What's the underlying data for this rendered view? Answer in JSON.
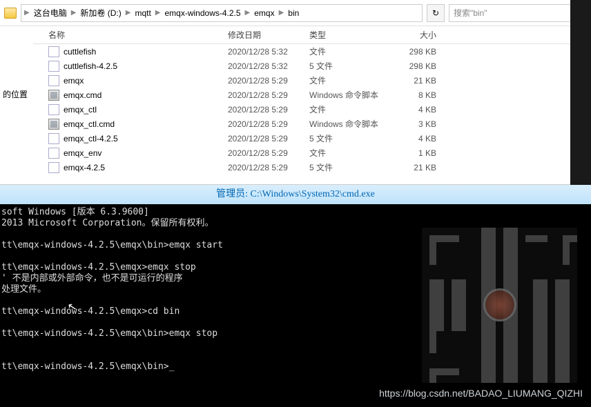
{
  "breadcrumb": [
    "这台电脑",
    "新加卷 (D:)",
    "mqtt",
    "emqx-windows-4.2.5",
    "emqx",
    "bin"
  ],
  "search_placeholder": "搜索\"bin\"",
  "sidebar_label": "的位置",
  "headers": {
    "name": "名称",
    "date": "修改日期",
    "type": "类型",
    "size": "大小"
  },
  "files": [
    {
      "name": "cuttlefish",
      "date": "2020/12/28 5:32",
      "type": "文件",
      "size": "298 KB",
      "icon": "file"
    },
    {
      "name": "cuttlefish-4.2.5",
      "date": "2020/12/28 5:32",
      "type": "5 文件",
      "size": "298 KB",
      "icon": "file"
    },
    {
      "name": "emqx",
      "date": "2020/12/28 5:29",
      "type": "文件",
      "size": "21 KB",
      "icon": "file"
    },
    {
      "name": "emqx.cmd",
      "date": "2020/12/28 5:29",
      "type": "Windows 命令脚本",
      "size": "8 KB",
      "icon": "cmd"
    },
    {
      "name": "emqx_ctl",
      "date": "2020/12/28 5:29",
      "type": "文件",
      "size": "4 KB",
      "icon": "file"
    },
    {
      "name": "emqx_ctl.cmd",
      "date": "2020/12/28 5:29",
      "type": "Windows 命令脚本",
      "size": "3 KB",
      "icon": "cmd"
    },
    {
      "name": "emqx_ctl-4.2.5",
      "date": "2020/12/28 5:29",
      "type": "5 文件",
      "size": "4 KB",
      "icon": "file"
    },
    {
      "name": "emqx_env",
      "date": "2020/12/28 5:29",
      "type": "文件",
      "size": "1 KB",
      "icon": "file"
    },
    {
      "name": "emqx-4.2.5",
      "date": "2020/12/28 5:29",
      "type": "5 文件",
      "size": "21 KB",
      "icon": "file"
    }
  ],
  "terminal": {
    "title": "管理员: C:\\Windows\\System32\\cmd.exe",
    "lines": [
      "soft Windows [版本 6.3.9600]",
      "2013 Microsoft Corporation。保留所有权利。",
      "",
      "tt\\emqx-windows-4.2.5\\emqx\\bin>emqx start",
      "",
      "tt\\emqx-windows-4.2.5\\emqx>emqx stop",
      "' 不是内部或外部命令，也不是可运行的程序",
      "处理文件。",
      "",
      "tt\\emqx-windows-4.2.5\\emqx>cd bin",
      "",
      "tt\\emqx-windows-4.2.5\\emqx\\bin>emqx stop",
      "",
      "",
      "tt\\emqx-windows-4.2.5\\emqx\\bin>_"
    ]
  },
  "watermark": "https://blog.csdn.net/BADAO_LIUMANG_QIZHI"
}
